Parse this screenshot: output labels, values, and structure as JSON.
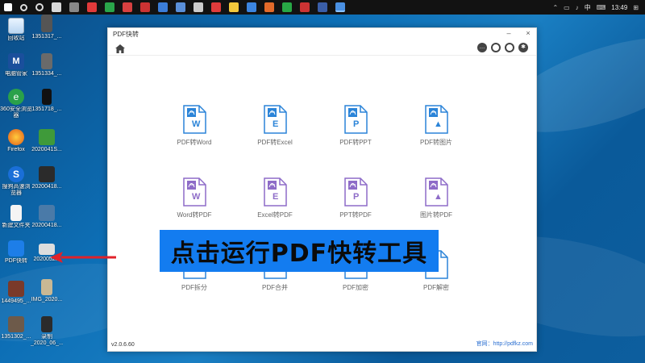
{
  "taskbar": {
    "time": "13:49",
    "ime": "中",
    "tray_badge": "⊞"
  },
  "desktop": {
    "icons": [
      {
        "label": "回收站"
      },
      {
        "label": "1351317_..."
      },
      {
        "label": "电脑管家"
      },
      {
        "label": "1351334_..."
      },
      {
        "label": "360安全浏览器"
      },
      {
        "label": "1351718_..."
      },
      {
        "label": "Firefox"
      },
      {
        "label": "2020041S..."
      },
      {
        "label": "搜狗高速浏览器"
      },
      {
        "label": "20200418..."
      },
      {
        "label": "新建文件夹"
      },
      {
        "label": "20200418..."
      },
      {
        "label": "PDF快转"
      },
      {
        "label": "2020052..."
      },
      {
        "label": "1449495_..."
      },
      {
        "label": "IMG_2020..."
      },
      {
        "label": "1351302_..."
      },
      {
        "label": "录制_2020_06_..."
      }
    ]
  },
  "window": {
    "title": "PDF快转",
    "tiles": [
      {
        "label": "PDF转Word",
        "letter": "W"
      },
      {
        "label": "PDF转Excel",
        "letter": "E"
      },
      {
        "label": "PDF转PPT",
        "letter": "P"
      },
      {
        "label": "PDF转图片",
        "letter": "▲"
      },
      {
        "label": "Word转PDF",
        "letter": "W"
      },
      {
        "label": "Excel转PDF",
        "letter": "E"
      },
      {
        "label": "PPT转PDF",
        "letter": "P"
      },
      {
        "label": "图片转PDF",
        "letter": "▲"
      },
      {
        "label": "PDF拆分",
        "letter": ""
      },
      {
        "label": "PDF合并",
        "letter": ""
      },
      {
        "label": "PDF加密",
        "letter": ""
      },
      {
        "label": "PDF解密",
        "letter": ""
      }
    ],
    "version": "v2.0.6.60",
    "website": "官网：http://pdfkz.com"
  },
  "banner": {
    "text": "点击运行PDF快转工具"
  },
  "colors": {
    "accent_blue": "#2b84d8",
    "accent_purple": "#8e6cc8",
    "banner_bg": "#137cf0",
    "arrow_red": "#e0222a"
  }
}
